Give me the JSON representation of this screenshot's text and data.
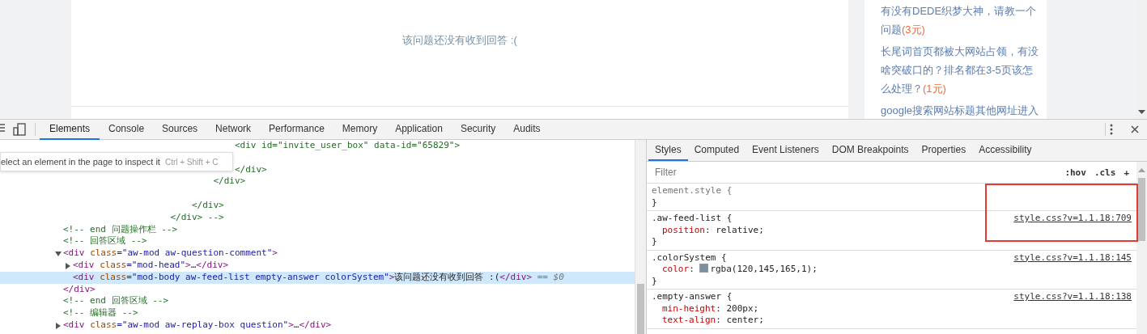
{
  "page": {
    "empty_message": "该问题还没有收到回答 :(",
    "sidebar_questions": [
      {
        "title": "有没有DEDE织梦大神，请教一个问题",
        "reward": "(3元)"
      },
      {
        "title": "长尾词首页都被大网站占领，有没啥突破口的？排名都在3-5页该怎么处理？",
        "reward": "(1元)"
      },
      {
        "title": "google搜索网站标题其他网址进入"
      }
    ]
  },
  "devtools": {
    "tabs": [
      {
        "label": "Elements",
        "selected": true
      },
      {
        "label": "Console",
        "selected": false
      },
      {
        "label": "Sources",
        "selected": false
      },
      {
        "label": "Network",
        "selected": false
      },
      {
        "label": "Performance",
        "selected": false
      },
      {
        "label": "Memory",
        "selected": false
      },
      {
        "label": "Application",
        "selected": false
      },
      {
        "label": "Security",
        "selected": false
      },
      {
        "label": "Audits",
        "selected": false
      }
    ],
    "inspect_tooltip": {
      "text": "elect an element in the page to inspect it",
      "shortcut": "Ctrl + Shift + C"
    },
    "dom_tree": [
      {
        "kind": "comment_text",
        "selected": false,
        "text": "                                <div id=\"invite_user_box\" data-id=\"65829\">\n\n                                </div>\n                            </div>\n\n                        </div>\n                    </div> -->"
      },
      {
        "kind": "line",
        "selected": false,
        "parts": [
          {
            "kind": "comment",
            "text": "<!-- end 问题操作栏 -->"
          }
        ]
      },
      {
        "kind": "line",
        "selected": false,
        "parts": [
          {
            "kind": "comment",
            "text": "<!-- 回答区域 -->"
          }
        ]
      },
      {
        "kind": "element",
        "selected": false,
        "expanded": true,
        "parts": [
          {
            "kind": "tag",
            "text": "<div "
          },
          {
            "kind": "attr",
            "text": "class"
          },
          {
            "kind": "value",
            "text": "=\"aw-mod aw-question-comment\""
          },
          {
            "kind": "tag",
            "text": ">"
          }
        ],
        "children": [
          {
            "kind": "element",
            "selected": false,
            "expanded": false,
            "parts": [
              {
                "kind": "tag",
                "text": "<div "
              },
              {
                "kind": "attr",
                "text": "class"
              },
              {
                "kind": "value",
                "text": "=\"mod-head\""
              },
              {
                "kind": "tag",
                "text": ">"
              },
              {
                "kind": "text",
                "text": "…"
              },
              {
                "kind": "tag",
                "text": "</div>"
              }
            ]
          },
          {
            "kind": "line",
            "selected": true,
            "parts": [
              {
                "kind": "tag",
                "text": "<div "
              },
              {
                "kind": "attr",
                "text": "class"
              },
              {
                "kind": "value",
                "text": "=\"mod-body aw-feed-list empty-answer colorSystem\""
              },
              {
                "kind": "tag",
                "text": ">"
              },
              {
                "kind": "text",
                "text": "该问题还没有收到回答 :("
              },
              {
                "kind": "tag",
                "text": "</div>"
              },
              {
                "kind": "marker",
                "text": " == $0"
              }
            ]
          }
        ],
        "closing": [
          {
            "kind": "tag",
            "text": "</div>"
          }
        ]
      },
      {
        "kind": "line",
        "selected": false,
        "parts": [
          {
            "kind": "comment",
            "text": "<!-- end 回答区域 -->"
          }
        ]
      },
      {
        "kind": "line",
        "selected": false,
        "parts": [
          {
            "kind": "comment",
            "text": "<!-- 编辑器 -->"
          }
        ]
      },
      {
        "kind": "element",
        "selected": false,
        "expanded": false,
        "parts": [
          {
            "kind": "tag",
            "text": "<div "
          },
          {
            "kind": "attr",
            "text": "class"
          },
          {
            "kind": "value",
            "text": "=\"aw-mod aw-replay-box question\""
          },
          {
            "kind": "tag",
            "text": ">"
          },
          {
            "kind": "text",
            "text": "…"
          },
          {
            "kind": "tag",
            "text": "</div>"
          }
        ]
      }
    ],
    "styles_tabs": [
      {
        "label": "Styles",
        "selected": true
      },
      {
        "label": "Computed",
        "selected": false
      },
      {
        "label": "Event Listeners",
        "selected": false
      },
      {
        "label": "DOM Breakpoints",
        "selected": false
      },
      {
        "label": "Properties",
        "selected": false
      },
      {
        "label": "Accessibility",
        "selected": false
      }
    ],
    "filter": {
      "placeholder": "Filter"
    },
    "filter_buttons": [
      ":hov",
      ".cls",
      "+"
    ],
    "rules": [
      {
        "kind": "inline",
        "selector": "element.style {",
        "close": "}"
      },
      {
        "kind": "rule",
        "selector": ".aw-feed-list {",
        "source": "style.css?v=1.1.18:709",
        "declarations": [
          {
            "property": "position",
            "separator": ": ",
            "value": "relative;"
          }
        ],
        "close": "}"
      },
      {
        "kind": "rule",
        "selector": ".colorSystem {",
        "source": "style.css?v=1.1.18:145",
        "declarations": [
          {
            "property": "color",
            "separator": ": ",
            "color": "#7891a5",
            "value": "rgba(120,145,165,1);"
          }
        ],
        "close": "}"
      },
      {
        "kind": "rule",
        "selector": ".empty-answer {",
        "source": "style.css?v=1.1.18:138",
        "declarations": [
          {
            "property": "min-height",
            "separator": ": ",
            "value": "200px;"
          },
          {
            "property": "text-align",
            "separator": ": ",
            "value": "center;"
          }
        ]
      }
    ]
  }
}
